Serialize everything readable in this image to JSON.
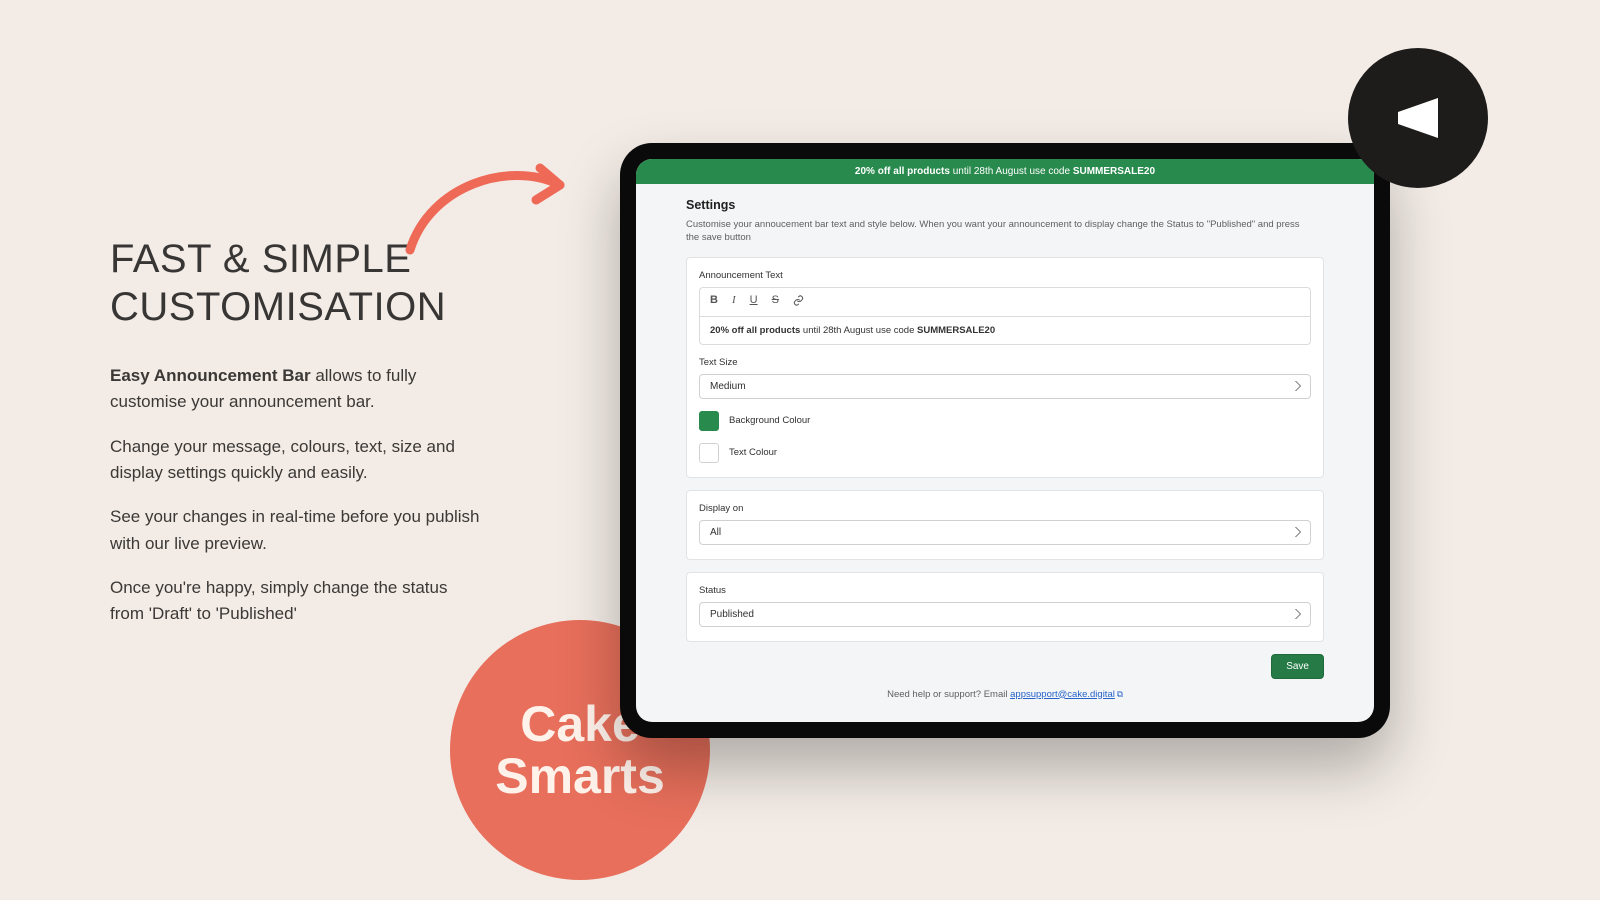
{
  "marketing": {
    "headline": "FAST & SIMPLE CUSTOMISATION",
    "p1_strong": "Easy Announcement Bar",
    "p1_rest": " allows to fully customise your announcement bar.",
    "p2": "Change your message, colours, text, size and display settings quickly and easily.",
    "p3": "See your changes in real-time before you publish with our live preview.",
    "p4": "Once you're happy, simply change the status from 'Draft' to 'Published'",
    "cake_line1": "Cake",
    "cake_line2": "Smarts"
  },
  "banner": {
    "strong": "20% off all products",
    "mid": " until 28th August use code ",
    "code": "SUMMERSALE20"
  },
  "settings": {
    "title": "Settings",
    "desc": "Customise your annoucement bar text and style below. When you want your announcement to display change the Status to \"Published\" and press the save button",
    "ann_label": "Announcement Text",
    "editor_strong": "20% off all products",
    "editor_mid": " until 28th August use code ",
    "editor_code": "SUMMERSALE20",
    "textsize_label": "Text Size",
    "textsize_value": "Medium",
    "bg_label": "Background Colour",
    "txt_label": "Text Colour",
    "display_label": "Display on",
    "display_value": "All",
    "status_label": "Status",
    "status_value": "Published",
    "save": "Save",
    "help_pre": "Need help or support? Email ",
    "help_email": "appsupport@cake.digital"
  },
  "colors": {
    "bg_swatch": "#298a4e",
    "text_swatch": "#ffffff"
  }
}
